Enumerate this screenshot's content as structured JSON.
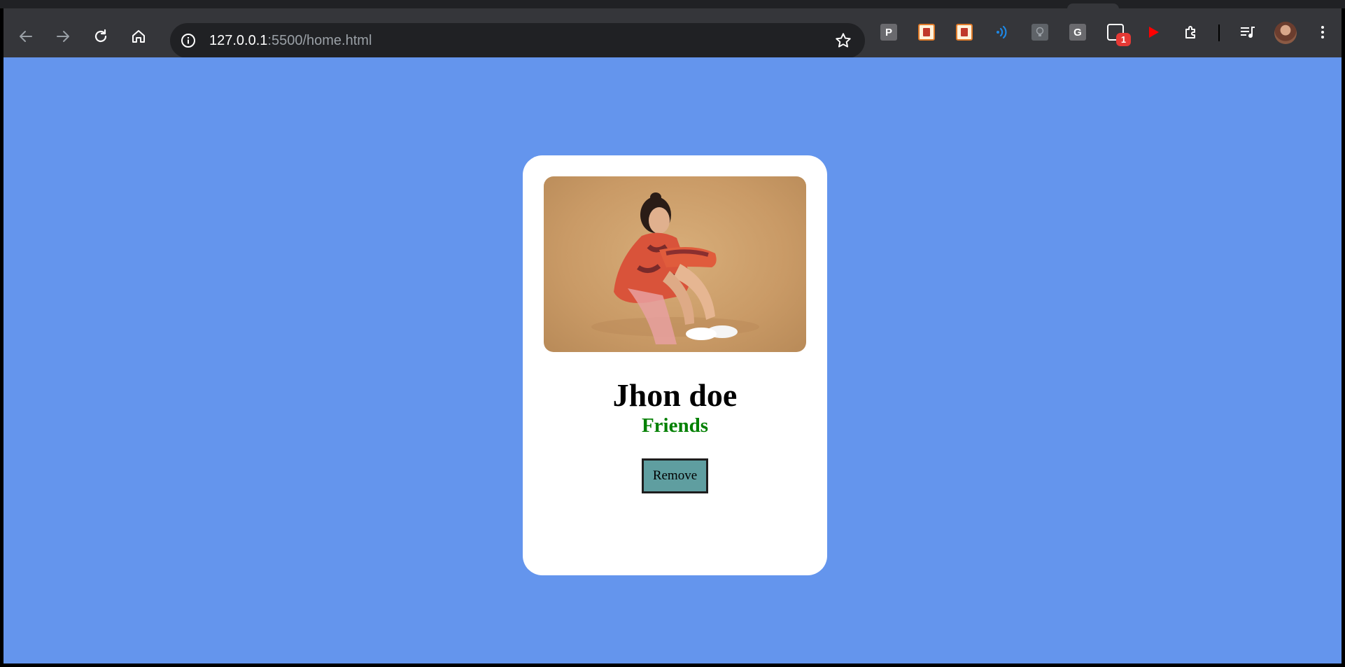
{
  "browser": {
    "url_host": "127.0.0.1",
    "url_path": ":5500/home.html",
    "extensions": [
      {
        "name": "P",
        "icon": "p-extension-icon"
      },
      {
        "name": "",
        "icon": "book-extension-icon"
      },
      {
        "name": "",
        "icon": "book-extension-icon"
      },
      {
        "name": "",
        "icon": "signal-extension-icon"
      },
      {
        "name": "",
        "icon": "lightbulb-extension-icon"
      },
      {
        "name": "G",
        "icon": "g-extension-icon"
      },
      {
        "name": "",
        "icon": "badge-extension-icon"
      },
      {
        "name": "",
        "icon": "youtube-play-icon"
      }
    ],
    "badge_count": "1",
    "colors": {
      "toolbar": "#35363a",
      "omnibox": "#202124",
      "badge": "#e53935"
    }
  },
  "page": {
    "background": "#6495ed",
    "card": {
      "image_alt": "Photo of a woman sitting on the floor",
      "name": "Jhon doe",
      "status": "Friends",
      "button_label": "Remove"
    },
    "colors": {
      "card": "#ffffff",
      "status": "#008000",
      "button": "#5f9ea0"
    }
  }
}
